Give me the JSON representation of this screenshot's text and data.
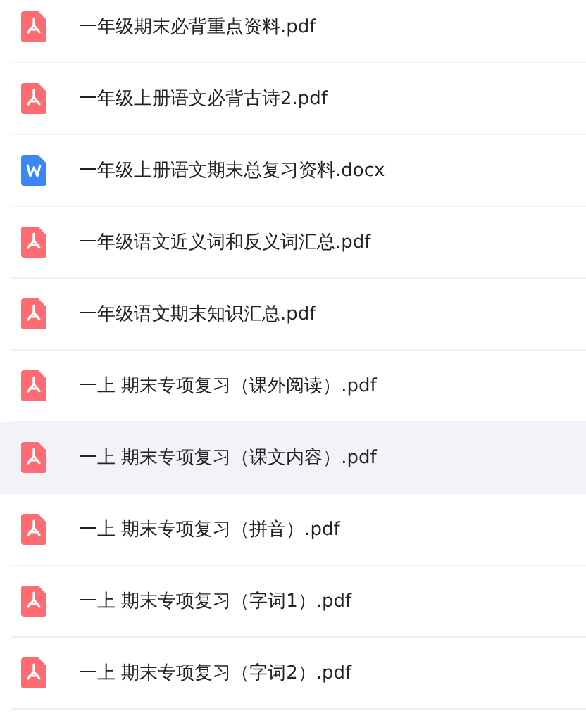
{
  "files": [
    {
      "name": "一年级期末必背重点资料.pdf",
      "kind": "pdf",
      "selected": false
    },
    {
      "name": "一年级上册语文必背古诗2.pdf",
      "kind": "pdf",
      "selected": false
    },
    {
      "name": "一年级上册语文期末总复习资料.docx",
      "kind": "word",
      "selected": false
    },
    {
      "name": "一年级语文近义词和反义词汇总.pdf",
      "kind": "pdf",
      "selected": false
    },
    {
      "name": "一年级语文期末知识汇总.pdf",
      "kind": "pdf",
      "selected": false
    },
    {
      "name": "一上 期末专项复习（课外阅读）.pdf",
      "kind": "pdf",
      "selected": false
    },
    {
      "name": "一上 期末专项复习（课文内容）.pdf",
      "kind": "pdf",
      "selected": true
    },
    {
      "name": "一上 期末专项复习（拼音）.pdf",
      "kind": "pdf",
      "selected": false
    },
    {
      "name": "一上 期末专项复习（字词1）.pdf",
      "kind": "pdf",
      "selected": false
    },
    {
      "name": "一上 期末专项复习（字词2）.pdf",
      "kind": "pdf",
      "selected": false
    }
  ]
}
